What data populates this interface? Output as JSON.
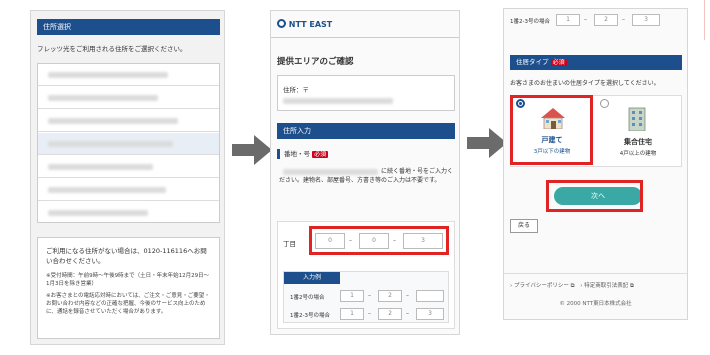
{
  "panel1": {
    "header": "住所選択",
    "instruction": "フレッツ光をご利用される住所をご選択ください。",
    "footer_main": "ご利用になる住所がない場合は、0120-116116へお問い合わせください。",
    "footer_note1": "※受付時間：午前9時〜午後9時まで（土日・年末年始12月29日〜1月3日を除き営業）",
    "footer_note2": "※お客さまとの電話応対時においては、ご注文・ご意見・ご要望・お問い合わせ内容などの正確な把握、今後のサービス向上のために、通話を録音させていただく場合があります。"
  },
  "panel2": {
    "logo": "NTT EAST",
    "title": "提供エリアのご確認",
    "address_label": "住所：〒",
    "section": "住所入力",
    "banchi_label": "番地・号",
    "required": "必須",
    "instruction": "に続く番地・号をご入力ください。建物名、部屋番号、方書き等のご入力は不要です。",
    "chome_label": "丁目",
    "fields": [
      "0",
      "0",
      "3"
    ],
    "example_header": "入力例",
    "example1_label": "1番2号の場合",
    "example1": [
      "1",
      "2",
      ""
    ],
    "example2_label": "1番2-3号の場合",
    "example2": [
      "1",
      "2",
      "3"
    ]
  },
  "panel3": {
    "top_example_label": "1番2-3号の場合",
    "top_example": [
      "1",
      "2",
      "3"
    ],
    "section": "住居タイプ",
    "required": "必須",
    "instruction": "お客さまのお住まいの住居タイプを選択してください。",
    "option1_title": "戸建て",
    "option1_sub": "3戸以下の建物",
    "option2_title": "集合住宅",
    "option2_sub": "4戸以上の建物",
    "next_button": "次へ",
    "back_button": "戻る",
    "footer_link1": "プライバシーポリシー",
    "footer_link2": "特定商取引法表記",
    "copyright": "© 2000 NTT東日本株式会社"
  },
  "colors": {
    "navy": "#1c4f8c",
    "red": "#e02424",
    "teal": "#3aa8a4",
    "arrow": "#6b6b6b"
  }
}
